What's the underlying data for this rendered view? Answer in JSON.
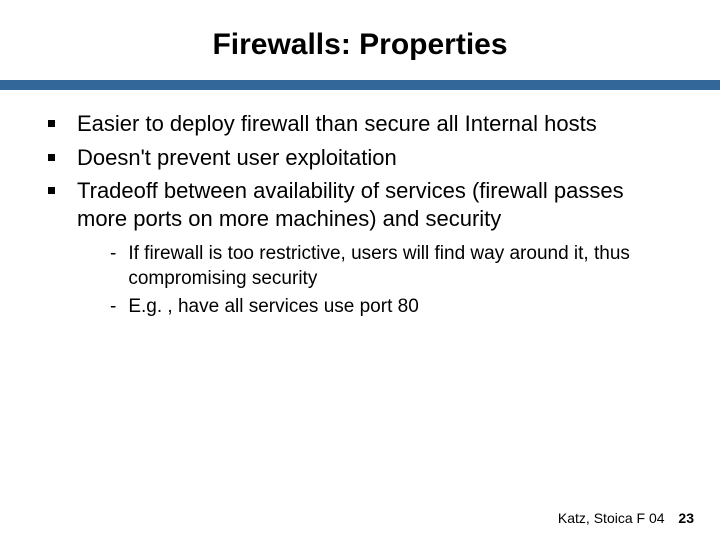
{
  "title": "Firewalls: Properties",
  "bullets": [
    {
      "text": "Easier to deploy firewall than secure all Internal hosts"
    },
    {
      "text": "Doesn't prevent user exploitation"
    },
    {
      "text": "Tradeoff between availability of services (firewall passes more ports on more machines) and security"
    }
  ],
  "subbullets": [
    {
      "text": "If firewall is too restrictive, users will find way around it, thus compromising security"
    },
    {
      "text": "E.g. , have all services use port 80"
    }
  ],
  "footer": {
    "credit": "Katz, Stoica F 04",
    "page": "23"
  }
}
